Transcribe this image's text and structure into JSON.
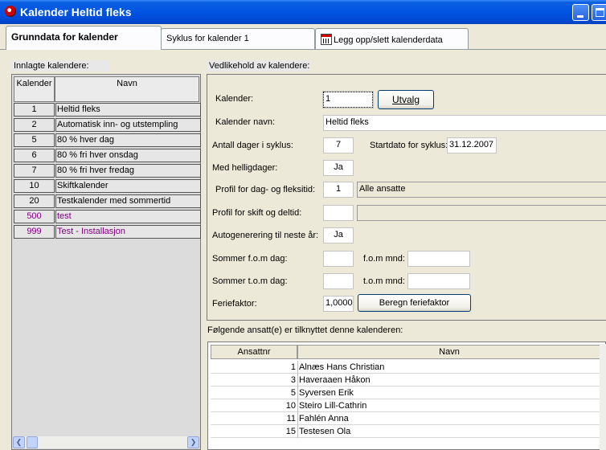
{
  "window": {
    "title": "Kalender Heltid fleks"
  },
  "tabs": [
    {
      "label": "Grunndata for kalender"
    },
    {
      "label": "Syklus for kalender 1"
    },
    {
      "label": "Legg opp/slett kalenderdata",
      "icon": "calendar-icon"
    }
  ],
  "left": {
    "section_label": "Innlagte kalendere:",
    "columns": [
      "Kalender",
      "Navn"
    ],
    "rows": [
      {
        "id": "1",
        "name": "Heltid fleks",
        "color": "#000000"
      },
      {
        "id": "2",
        "name": "Automatisk inn- og utstempling",
        "color": "#000000"
      },
      {
        "id": "5",
        "name": "80 % hver dag",
        "color": "#000000"
      },
      {
        "id": "6",
        "name": "80 % fri hver onsdag",
        "color": "#000000"
      },
      {
        "id": "7",
        "name": "80 % fri hver fredag",
        "color": "#000000"
      },
      {
        "id": "10",
        "name": "Skiftkalender",
        "color": "#000000"
      },
      {
        "id": "20",
        "name": "Testkalender med sommertid",
        "color": "#000000"
      },
      {
        "id": "500",
        "name": "test",
        "color": "#800080"
      },
      {
        "id": "999",
        "name": "Test - Installasjon",
        "color": "#800080"
      }
    ]
  },
  "form": {
    "section_label": "Vedlikehold av kalendere:",
    "kalender_label": "Kalender:",
    "kalender_value": "1",
    "utvalg_button": "Utvalg",
    "navn_label": "Kalender navn:",
    "navn_value": "Heltid fleks",
    "dager_label": "Antall dager i syklus:",
    "dager_value": "7",
    "startdato_label": "Startdato for syklus:",
    "startdato_value": "31.12.2007",
    "helligdager_label": "Med helligdager:",
    "helligdager_value": "Ja",
    "profil_fleks_label": "Profil for dag- og fleksitid:",
    "profil_fleks_value": "1",
    "profil_fleks_name": "Alle ansatte",
    "profil_skift_label": "Profil for skift og deltid:",
    "profil_skift_value": "",
    "profil_skift_name": "",
    "autogen_label": "Autogenerering til neste år:",
    "autogen_value": "Ja",
    "sommer_fom_dag_label": "Sommer f.o.m dag:",
    "sommer_fom_mnd_label": "f.o.m mnd:",
    "sommer_tom_dag_label": "Sommer t.o.m dag:",
    "sommer_tom_mnd_label": "t.o.m mnd:",
    "feriefaktor_label": "Feriefaktor:",
    "feriefaktor_value": "1,0000",
    "beregn_button": "Beregn feriefaktor"
  },
  "employees": {
    "section_label": "Følgende ansatt(e) er tilknyttet denne kalenderen:",
    "columns": [
      "Ansattnr",
      "Navn"
    ],
    "rows": [
      {
        "nr": "1",
        "name": "Alnæs Hans Christian"
      },
      {
        "nr": "3",
        "name": "Haveraaen Håkon"
      },
      {
        "nr": "5",
        "name": "Syversen Erik"
      },
      {
        "nr": "10",
        "name": "Steiro Lill-Cathrin"
      },
      {
        "nr": "11",
        "name": "Fahlén Anna"
      },
      {
        "nr": "15",
        "name": "Testesen Ola"
      }
    ]
  }
}
